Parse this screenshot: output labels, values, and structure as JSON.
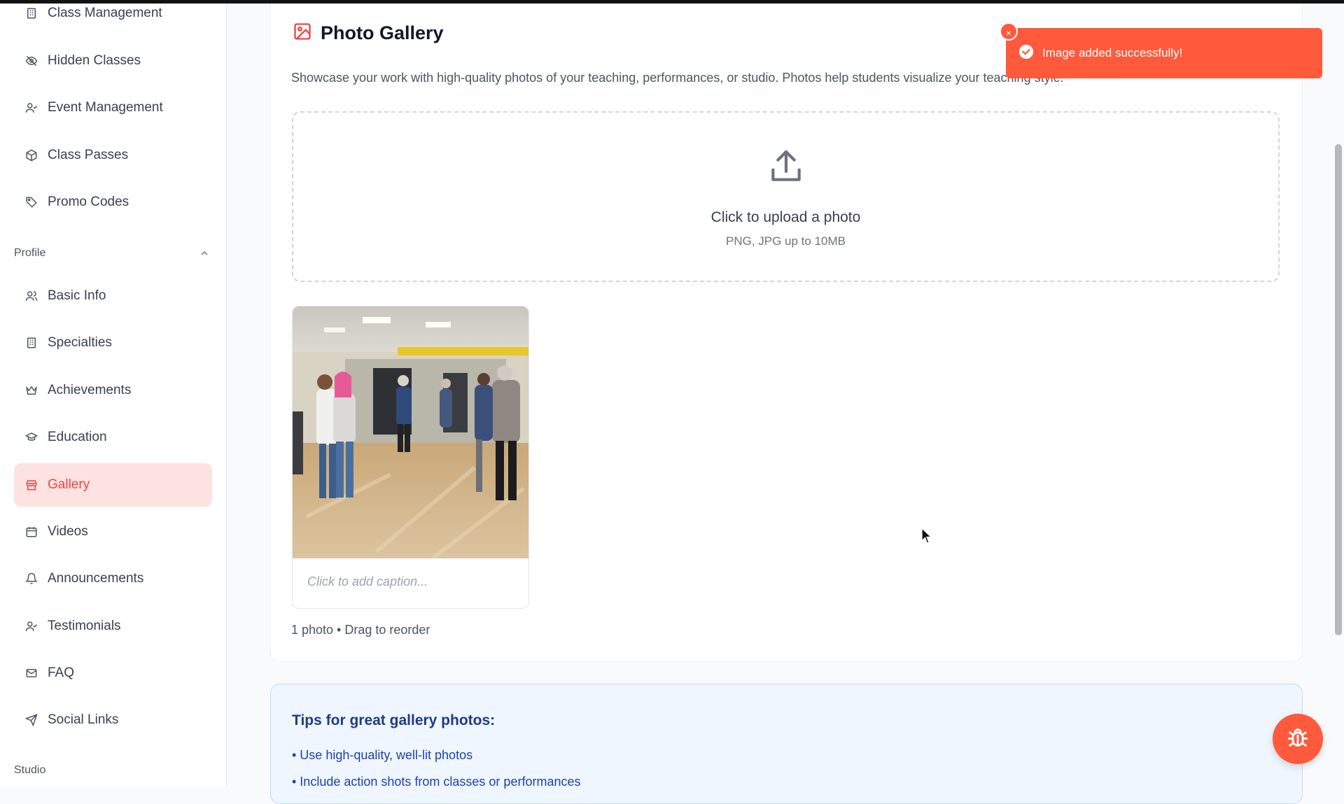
{
  "sidebar": {
    "items_top": [
      {
        "label": "Class Management",
        "icon": "building-icon"
      },
      {
        "label": "Hidden Classes",
        "icon": "eye-off-icon"
      },
      {
        "label": "Event Management",
        "icon": "user-check-icon"
      },
      {
        "label": "Class Passes",
        "icon": "package-icon"
      },
      {
        "label": "Promo Codes",
        "icon": "tag-icon"
      }
    ],
    "profile_section": "Profile",
    "items_profile": [
      {
        "label": "Basic Info",
        "icon": "users-icon"
      },
      {
        "label": "Specialties",
        "icon": "building-icon"
      },
      {
        "label": "Achievements",
        "icon": "crown-icon"
      },
      {
        "label": "Education",
        "icon": "graduation-cap-icon"
      },
      {
        "label": "Gallery",
        "icon": "store-icon",
        "active": true
      },
      {
        "label": "Videos",
        "icon": "calendar-icon"
      },
      {
        "label": "Announcements",
        "icon": "bell-icon"
      },
      {
        "label": "Testimonials",
        "icon": "user-check-icon"
      },
      {
        "label": "FAQ",
        "icon": "mail-icon"
      },
      {
        "label": "Social Links",
        "icon": "send-icon"
      }
    ],
    "studio_section": "Studio"
  },
  "main": {
    "title": "Photo Gallery",
    "description": "Showcase your work with high-quality photos of your teaching, performances, or studio. Photos help students visualize your teaching style.",
    "upload": {
      "title": "Click to upload a photo",
      "subtitle": "PNG, JPG up to 10MB"
    },
    "photo_caption_placeholder": "Click to add caption...",
    "photo_count": "1 photo • Drag to reorder",
    "tips": {
      "title": "Tips for great gallery photos:",
      "items": [
        "• Use high-quality, well-lit photos",
        "• Include action shots from classes or performances"
      ]
    }
  },
  "toast": {
    "message": "Image added successfully!",
    "close": "×"
  },
  "colors": {
    "accent": "#ff5a3c",
    "active_bg": "#fde2e2",
    "active_text": "#ef4444"
  }
}
